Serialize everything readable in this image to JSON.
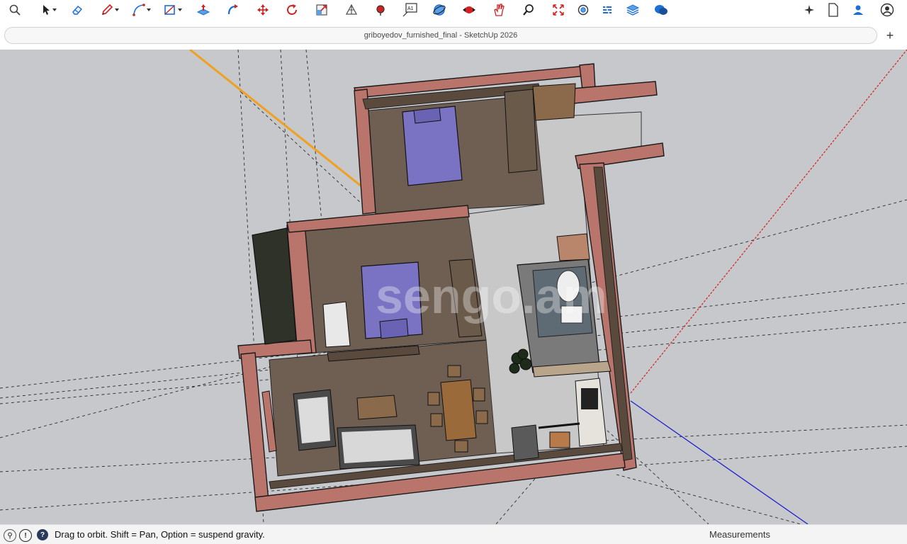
{
  "toolbar": {
    "tools": [
      {
        "name": "search-icon"
      },
      {
        "name": "select-icon"
      },
      {
        "name": "eraser-icon"
      },
      {
        "name": "pencil-icon"
      },
      {
        "name": "arc-icon"
      },
      {
        "name": "rectangle-icon"
      },
      {
        "name": "push-pull-icon"
      },
      {
        "name": "follow-me-icon"
      },
      {
        "name": "move-icon"
      },
      {
        "name": "rotate-icon"
      },
      {
        "name": "scale-icon"
      },
      {
        "name": "section-plane-icon"
      },
      {
        "name": "paint-bucket-icon"
      },
      {
        "name": "text-icon"
      },
      {
        "name": "orbit-icon"
      },
      {
        "name": "pan-icon"
      },
      {
        "name": "hand-icon"
      },
      {
        "name": "zoom-icon"
      },
      {
        "name": "zoom-extents-icon"
      },
      {
        "name": "components-icon"
      },
      {
        "name": "styles-icon"
      },
      {
        "name": "layers-icon"
      },
      {
        "name": "chat-icon"
      }
    ],
    "right": [
      {
        "name": "sparkle-icon"
      },
      {
        "name": "document-icon"
      },
      {
        "name": "account-icon"
      },
      {
        "name": "profile-icon"
      }
    ],
    "accent_color": "#1a6fd8"
  },
  "window": {
    "title": "griboyedov_furnished_final - SketchUp 2026",
    "new_tab_label": "+"
  },
  "status": {
    "text": "Drag to orbit. Shift = Pan, Option = suspend gravity.",
    "measurements_label": "Measurements"
  },
  "watermark": {
    "text": "sengo.am"
  },
  "colors": {
    "viewport_bg": "#c7c8cb",
    "walls": "#b9756b",
    "floor_wood": "#6f5f52",
    "floor_tile": "#c7c7c7",
    "bed": "#7a72c2",
    "axis_red": "#d32020",
    "axis_blue": "#2020d0",
    "axis_orange": "#f0a020"
  }
}
